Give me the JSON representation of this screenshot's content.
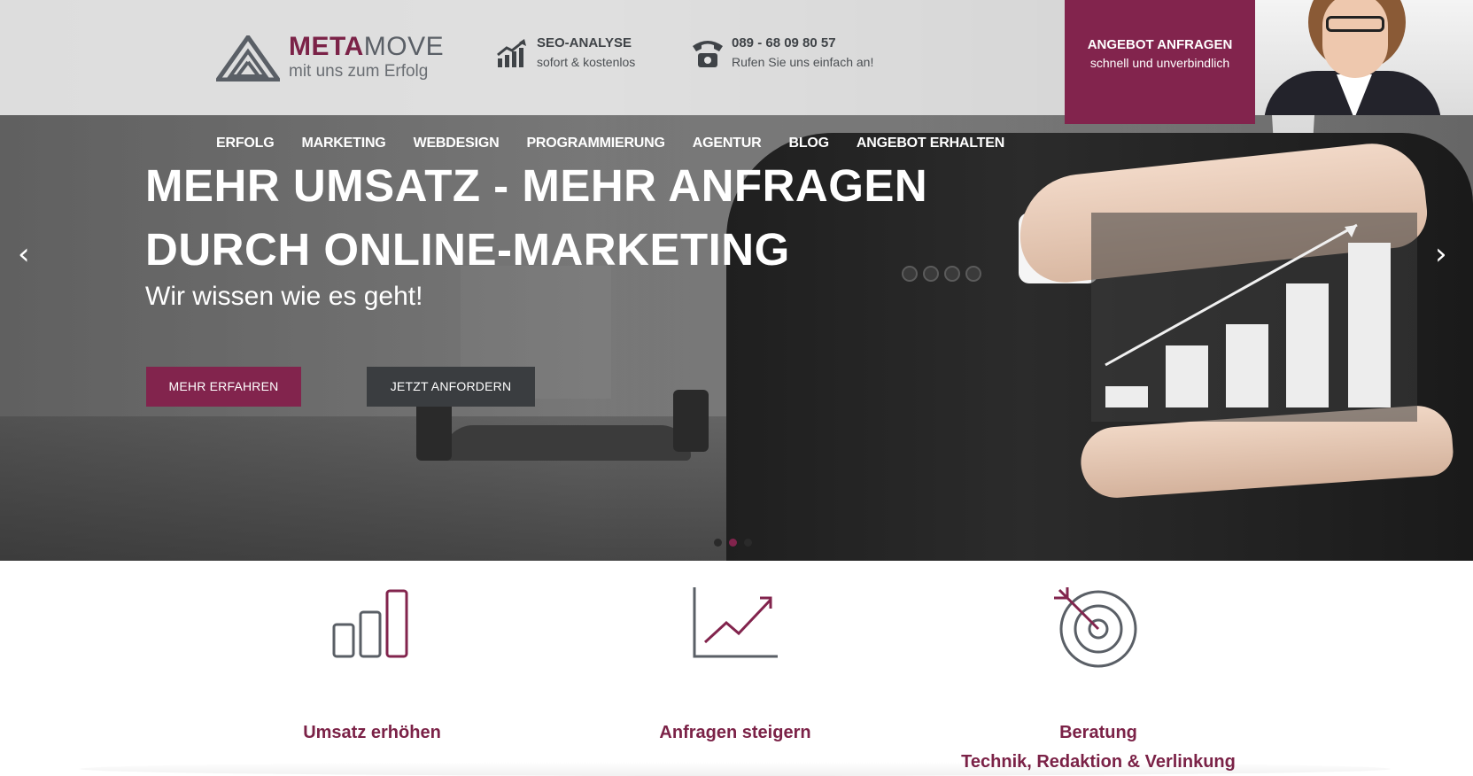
{
  "brand": {
    "name_part1": "META",
    "name_part2": "MOVE",
    "tagline": "mit uns zum Erfolg"
  },
  "info_seo": {
    "title": "SEO-ANALYSE",
    "subtitle": "sofort & kostenlos",
    "icon": "bar-chart-growth-icon"
  },
  "info_phone": {
    "title": "089 - 68 09 80 57",
    "subtitle": "Rufen Sie uns einfach an!",
    "icon": "telephone-icon"
  },
  "cta_top": {
    "title": "ANGEBOT ANFRAGEN",
    "subtitle": "schnell und unverbindlich"
  },
  "nav": {
    "items": [
      {
        "label": "ERFOLG"
      },
      {
        "label": "MARKETING"
      },
      {
        "label": "WEBDESIGN"
      },
      {
        "label": "PROGRAMMIERUNG"
      },
      {
        "label": "AGENTUR"
      },
      {
        "label": "BLOG"
      },
      {
        "label": "ANGEBOT ERHALTEN"
      }
    ]
  },
  "hero": {
    "headline_line1": "MEHR UMSATZ - MEHR ANFRAGEN",
    "headline_line2": "DURCH ONLINE-MARKETING",
    "subline": "Wir wissen wie es geht!",
    "button_primary": "MEHR ERFAHREN",
    "button_secondary": "JETZT ANFORDERN",
    "prev_arrow": "‹",
    "next_arrow": "›",
    "slides": 3,
    "active_slide": 2
  },
  "features": [
    {
      "label": "Umsatz erhöhen",
      "icon": "bar-chart-icon"
    },
    {
      "label": "Anfragen steigern",
      "icon": "line-chart-icon"
    },
    {
      "label_line1": "Beratung",
      "label_line2": "Technik, Redaktion & Verlinkung",
      "icon": "target-icon"
    }
  ],
  "colors": {
    "accent": "#82244d",
    "dark": "#3a3d40",
    "text_gray": "#5a5f66"
  }
}
